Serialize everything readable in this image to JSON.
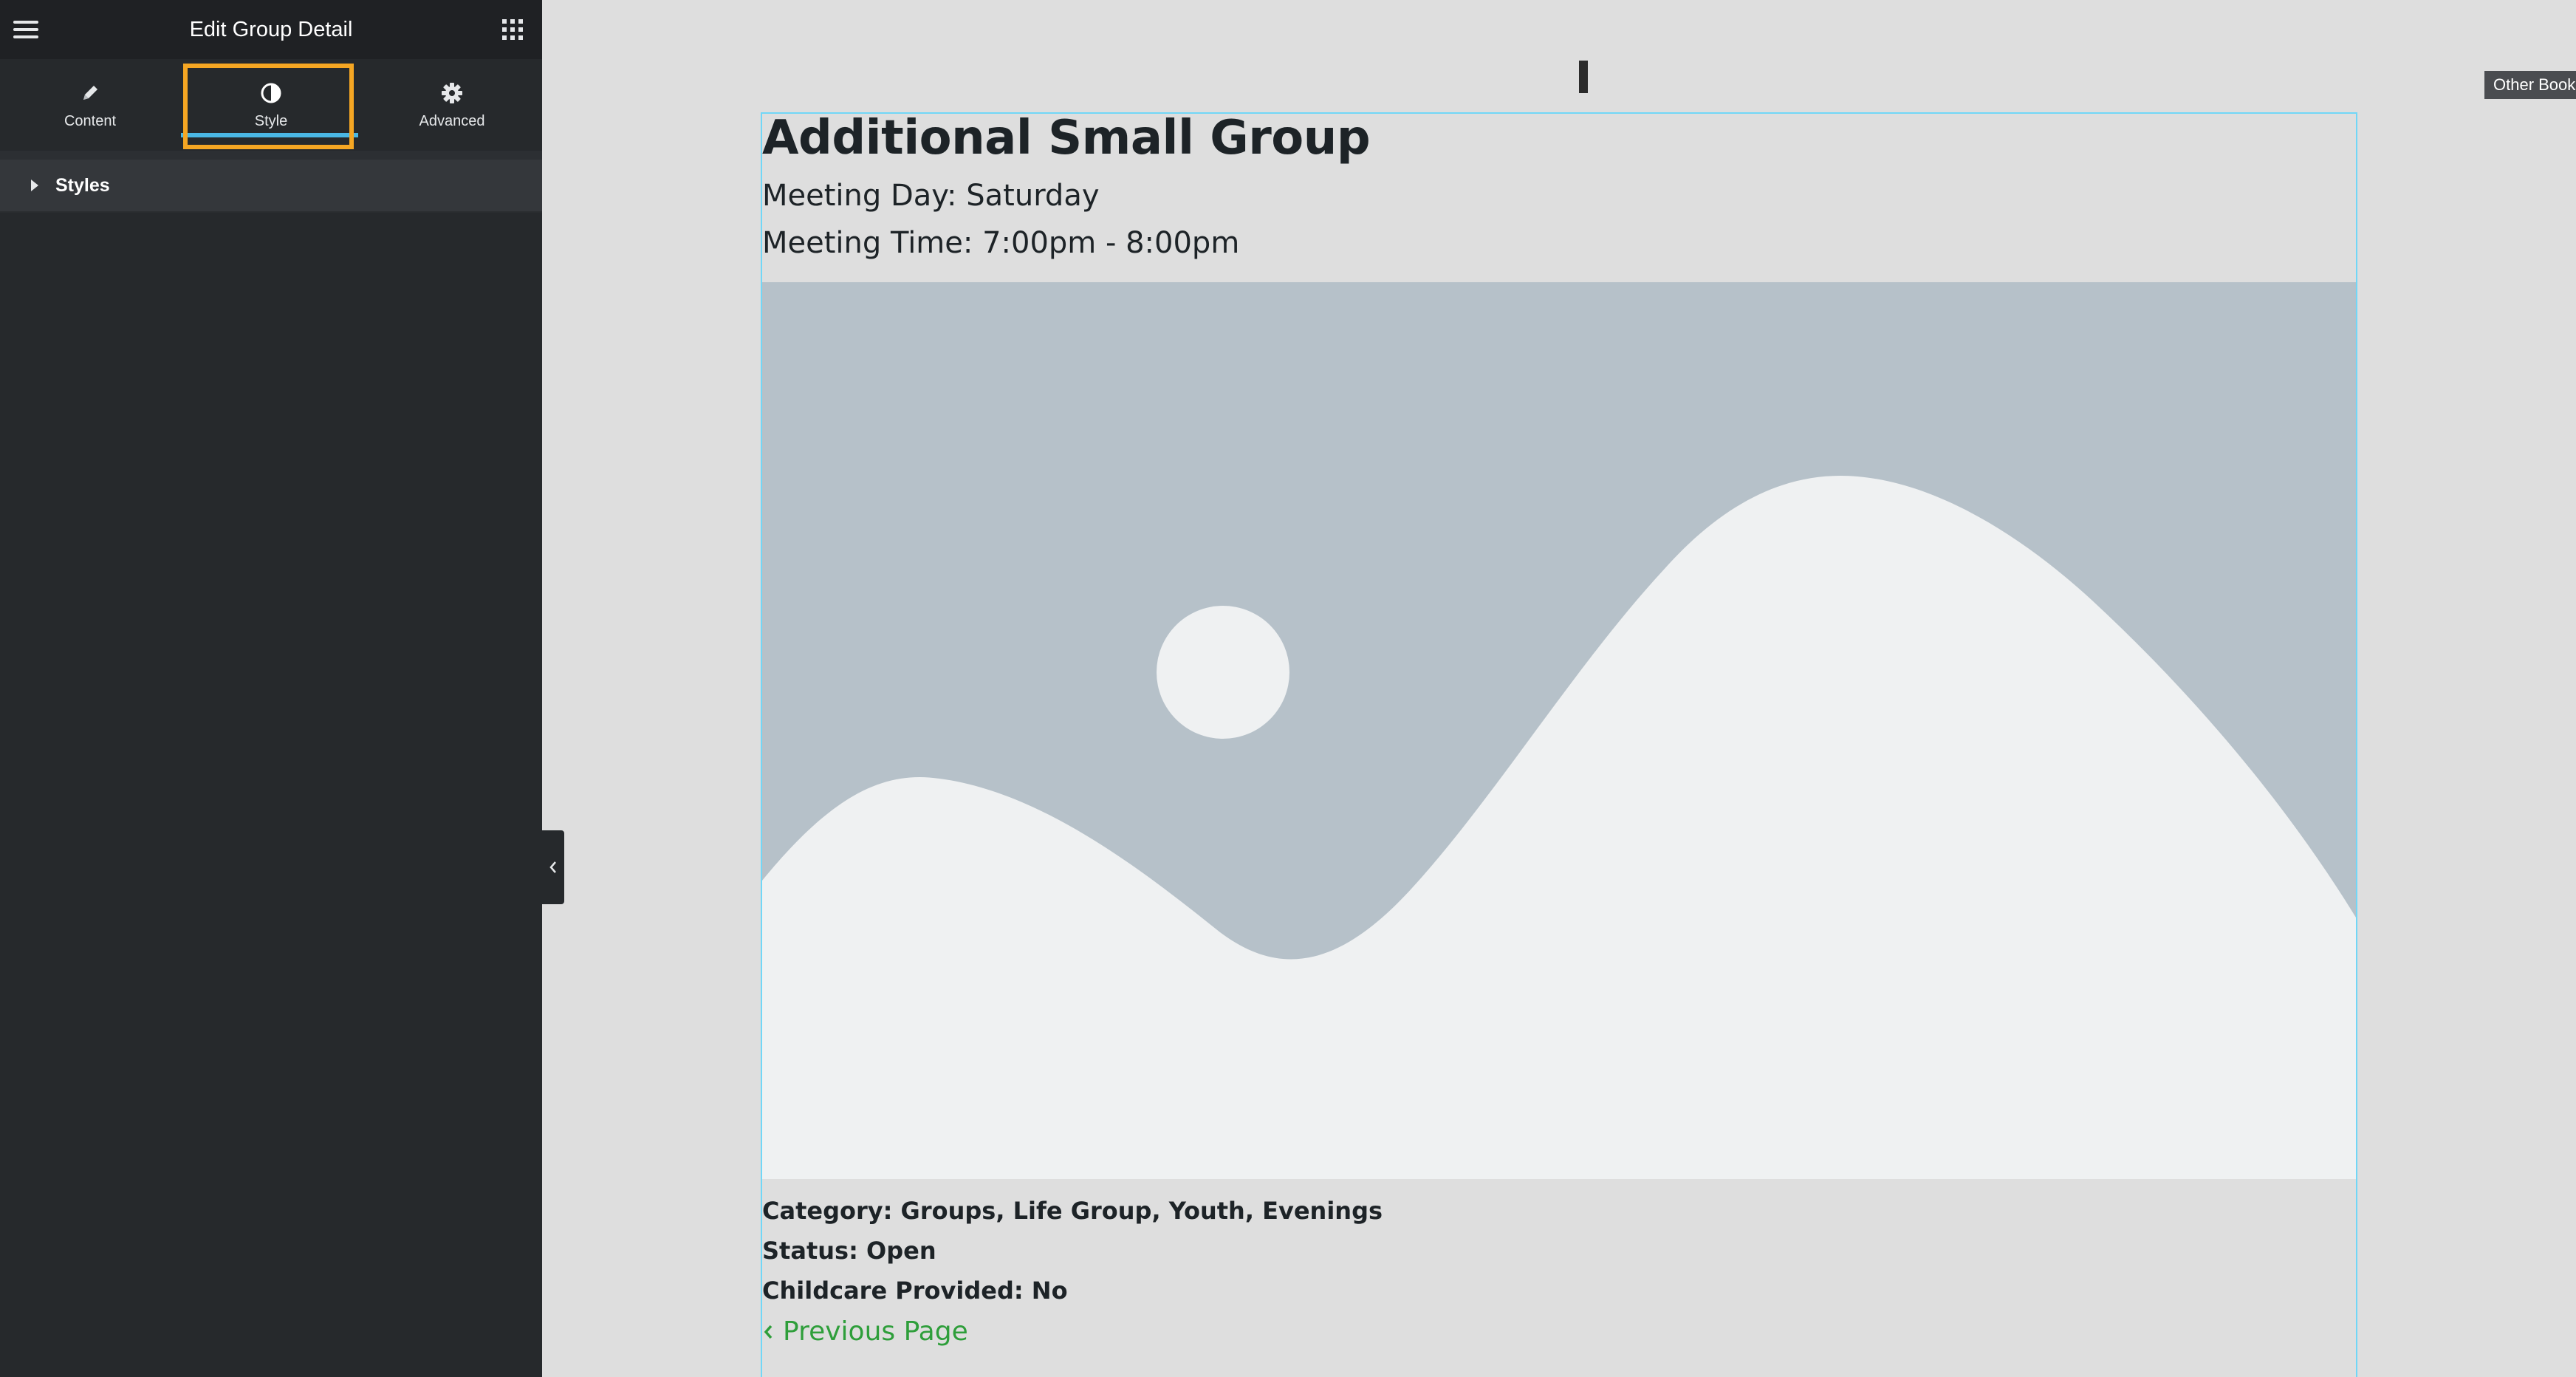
{
  "panel": {
    "title": "Edit Group Detail",
    "tabs": [
      {
        "label": "Content",
        "icon": "pencil-icon"
      },
      {
        "label": "Style",
        "icon": "half-circle-icon",
        "active": true
      },
      {
        "label": "Advanced",
        "icon": "gear-icon"
      }
    ],
    "section": {
      "label": "Styles",
      "expanded": false
    },
    "colors": {
      "background": "#26292c",
      "accent": "#4ab7e4",
      "highlight": "#f5a623"
    }
  },
  "tooltip": {
    "text": "Other Books"
  },
  "group": {
    "title": "Additional Small Group",
    "meeting_day": "Meeting Day: Saturday",
    "meeting_time": "Meeting Time: 7:00pm - 8:00pm",
    "image": {
      "icon": "image-placeholder-icon"
    },
    "category": "Category: Groups, Life Group, Youth, Evenings",
    "status": "Status: Open",
    "childcare": "Childcare Provided: No",
    "previous_link": "Previous Page",
    "link_color": "#2e9e3a"
  }
}
